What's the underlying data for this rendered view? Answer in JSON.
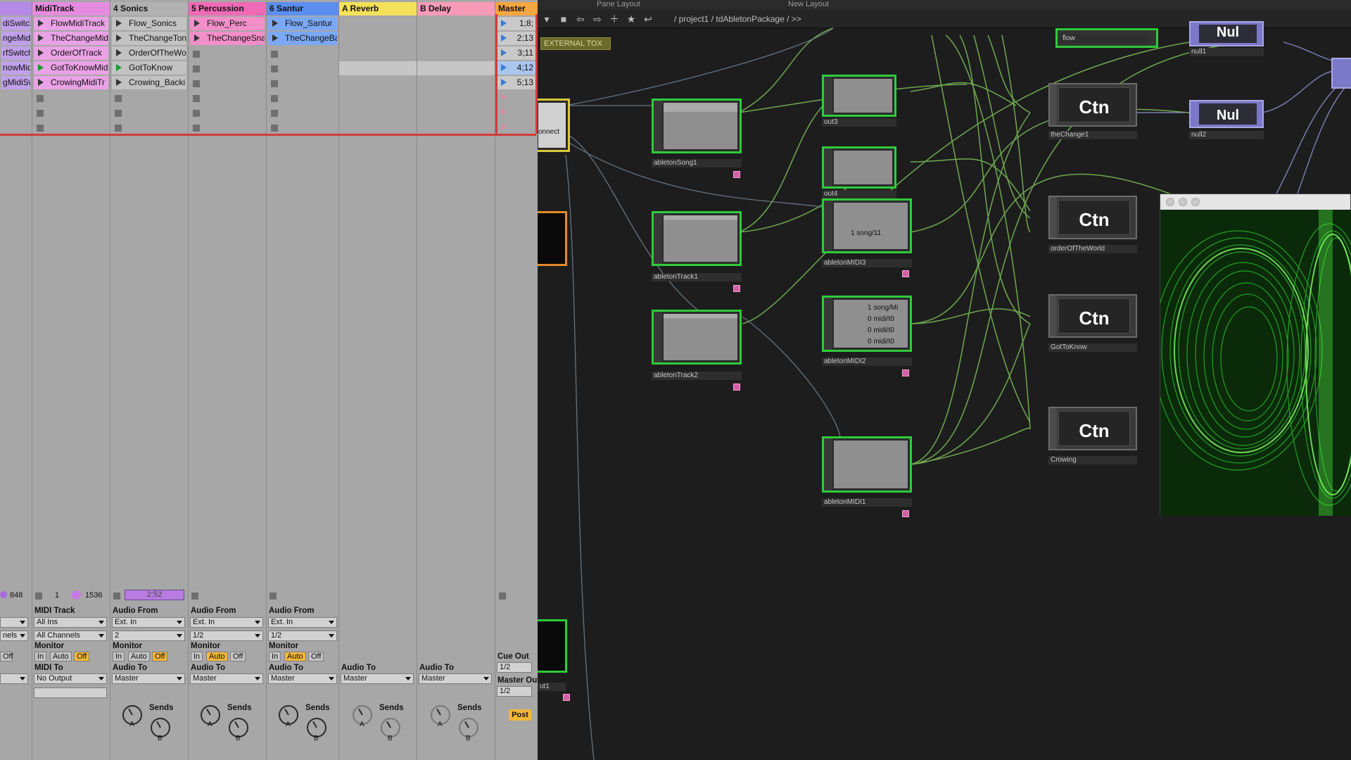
{
  "ableton": {
    "tracks": [
      {
        "name": "",
        "color": "#b58ae6",
        "clips": [
          "diSwitch",
          "ngeMidi",
          "rfSwitch",
          "nowMidi",
          "gMidiSw"
        ],
        "clip_color": "#c0a0ea"
      },
      {
        "name": "MidiTrack",
        "color": "#e58ce0",
        "clips": [
          "FlowMidiTrack",
          "TheChangeMidi",
          "OrderOfTrack",
          "GotToKnowMid",
          "CrowingMidiTr"
        ],
        "clip_color": "#eaa2e6"
      },
      {
        "name": "4 Sonics",
        "color": "#b2b2b2",
        "clips": [
          "Flow_Sonics",
          "TheChangeTon",
          "OrderOfTheWo",
          "GotToKnow",
          "Crowing_Backi"
        ],
        "clip_color": "#c2c2c2"
      },
      {
        "name": "5 Percussion",
        "color": "#f06bb6",
        "clips": [
          "Flow_Perc",
          "TheChangeSna"
        ],
        "clip_color": "#f28fc9"
      },
      {
        "name": "6 Santur",
        "color": "#5b8ef0",
        "clips": [
          "Flow_Santur",
          "TheChangeBa"
        ],
        "clip_color": "#7aa8f4"
      },
      {
        "name": "A Reverb",
        "color": "#f4e15a",
        "clips": [],
        "clip_color": "#f4e15a"
      },
      {
        "name": "B Delay",
        "color": "#f79ab8",
        "clips": [],
        "clip_color": "#f79ab8"
      },
      {
        "name": "Master",
        "color": "#f4a640",
        "clips": [
          "1;8;",
          "2;13",
          "3;11",
          "4;12",
          "5;13"
        ],
        "clip_color": "#c9c9c9"
      }
    ],
    "status": {
      "v1": "848",
      "v2": "1",
      "v3": "1536",
      "time": "2:52"
    },
    "io": {
      "midi_from": "MIDI Track",
      "all_ins": "All Ins",
      "all_channels": "All Channels",
      "audio_from": "Audio From",
      "ext_in": "Ext. In",
      "ch2": "2",
      "ch12": "1/2",
      "monitor": "Monitor",
      "in": "In",
      "auto": "Auto",
      "off": "Off",
      "midi_to": "MIDI To",
      "no_output": "No Output",
      "audio_to": "Audio To",
      "master": "Master",
      "cue_out": "Cue Out",
      "cue_val": "1/2",
      "master_out": "Master Out",
      "master_out_val": "1/2",
      "sends": "Sends",
      "post": "Post",
      "knob_a": "A",
      "knob_b": "B",
      "chann": "nels"
    }
  },
  "td": {
    "top_tabs": [
      "Pane Layout",
      "New Layout"
    ],
    "path": "/ project1 / tdAbletonPackage / >>",
    "ext_tox": "EXTERNAL TOX",
    "nodes": {
      "abletonSong1": "abletonSong1",
      "abletonTrack1": "abletonTrack1",
      "abletonTrack2": "abletonTrack2",
      "out3": "out3",
      "out4": "out4",
      "abletonMIDI3": "abletonMIDI3",
      "abletonMIDI2": "abletonMIDI2",
      "abletonMIDI1": "abletonMIDI1",
      "flow": "flow",
      "null1": "null1",
      "null2": "null2",
      "theChange1": "theChange1",
      "orderOfTheWorld": "orderOfTheWorld",
      "GotToKnow": "GotToKnow",
      "Crowing": "Crowing",
      "connect": "onnect",
      "out1": "ut1"
    },
    "ctn_label": "Ctn",
    "nul_label": "Nul",
    "midi3_text": "1 song/11",
    "midi2_lines": [
      "1 song/Mi",
      "0 midi/t0",
      "0 midi/t0",
      "0 midi/t0"
    ]
  }
}
